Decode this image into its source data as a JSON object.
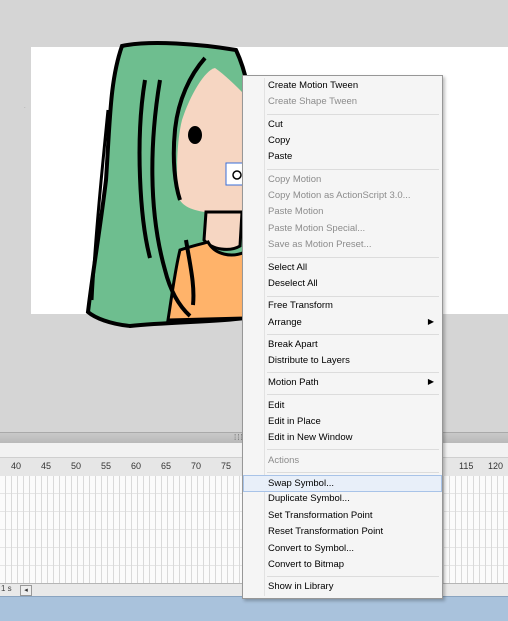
{
  "timeline": {
    "ruler_ticks": [
      "40",
      "45",
      "50",
      "55",
      "60",
      "65",
      "70",
      "75",
      "115",
      "120"
    ],
    "scroll_left_glyph": "◂",
    "frame_indicator": "1 s"
  },
  "context_menu": {
    "items": [
      {
        "label": "Create Motion Tween",
        "enabled": true
      },
      {
        "label": "Create Shape Tween",
        "enabled": false
      },
      {
        "label": "Cut",
        "enabled": true
      },
      {
        "label": "Copy",
        "enabled": true
      },
      {
        "label": "Paste",
        "enabled": true
      },
      {
        "label": "Copy Motion",
        "enabled": false
      },
      {
        "label": "Copy Motion as ActionScript 3.0...",
        "enabled": false
      },
      {
        "label": "Paste Motion",
        "enabled": false
      },
      {
        "label": "Paste Motion Special...",
        "enabled": false
      },
      {
        "label": "Save as Motion Preset...",
        "enabled": false
      },
      {
        "label": "Select All",
        "enabled": true
      },
      {
        "label": "Deselect All",
        "enabled": true
      },
      {
        "label": "Free Transform",
        "enabled": true
      },
      {
        "label": "Arrange",
        "enabled": true,
        "submenu": true
      },
      {
        "label": "Break Apart",
        "enabled": true
      },
      {
        "label": "Distribute to Layers",
        "enabled": true
      },
      {
        "label": "Motion Path",
        "enabled": true,
        "submenu": true
      },
      {
        "label": "Edit",
        "enabled": true
      },
      {
        "label": "Edit in Place",
        "enabled": true
      },
      {
        "label": "Edit in New Window",
        "enabled": true
      },
      {
        "label": "Actions",
        "enabled": false
      },
      {
        "label": "Swap Symbol...",
        "enabled": true,
        "highlighted": true
      },
      {
        "label": "Duplicate Symbol...",
        "enabled": true
      },
      {
        "label": "Set Transformation Point",
        "enabled": true
      },
      {
        "label": "Reset Transformation Point",
        "enabled": true
      },
      {
        "label": "Convert to Symbol...",
        "enabled": true
      },
      {
        "label": "Convert to Bitmap",
        "enabled": true
      },
      {
        "label": "Show in Library",
        "enabled": true
      }
    ],
    "submenu_arrow": "▶"
  },
  "colors": {
    "hair": "#6ebe8f",
    "skin": "#f6d6c2",
    "shirt": "#ffb36a",
    "menu_highlight": "#e8eff9"
  }
}
